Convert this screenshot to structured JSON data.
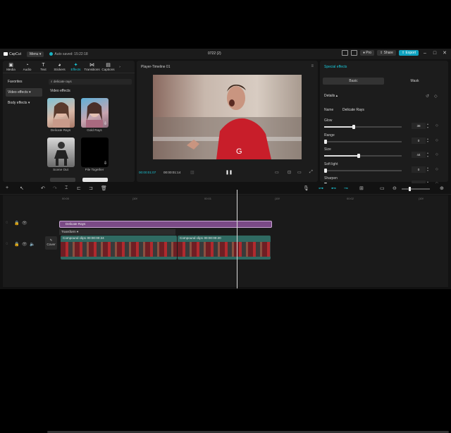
{
  "topbar": {
    "logo_text": "CapCut",
    "menu_label": "Menu",
    "autosave_text": "Auto saved: 15:22:18",
    "project_title": "0722 (2)",
    "pro_label": "Pro",
    "share_label": "Share",
    "export_label": "Export"
  },
  "toolbar": [
    {
      "icon": "media-icon",
      "glyph": "▣",
      "label": "Media"
    },
    {
      "icon": "audio-icon",
      "glyph": "◔",
      "label": "Audio"
    },
    {
      "icon": "text-icon",
      "glyph": "T",
      "label": "Text"
    },
    {
      "icon": "stickers-icon",
      "glyph": "◕",
      "label": "Stickers"
    },
    {
      "icon": "effects-icon",
      "glyph": "✦",
      "label": "Effects",
      "active": true
    },
    {
      "icon": "transitions-icon",
      "glyph": "⋈",
      "label": "Transitions"
    },
    {
      "icon": "captions-icon",
      "glyph": "▤",
      "label": "Captions"
    }
  ],
  "effects_panel": {
    "categories": [
      "Favorites",
      "Video effects",
      "Body effects"
    ],
    "search_value": "delicate rays",
    "section_label": "Video effects",
    "thumbs": [
      {
        "label": "Delicate Rays"
      },
      {
        "label": "Gold Rays"
      },
      {
        "label": "Scene Out"
      },
      {
        "label": "Pile Together"
      }
    ]
  },
  "player": {
    "title": "Player-Timeline 01",
    "current_time": "00:00:01:07",
    "total_time": "00:00:01:14"
  },
  "special_effects": {
    "heading": "Special effects",
    "tabs": [
      "Basic",
      "Mask"
    ],
    "details_label": "Details",
    "name_label": "Name",
    "name_value": "Delicate Rays",
    "params": [
      {
        "label": "Glow",
        "value": "38",
        "fraction": 0.38
      },
      {
        "label": "Range",
        "value": "0",
        "fraction": 0.0
      },
      {
        "label": "Size",
        "value": "44",
        "fraction": 0.44
      },
      {
        "label": "Soft light",
        "value": "0",
        "fraction": 0.0
      },
      {
        "label": "Sharpen",
        "value": "",
        "fraction": 0.0
      }
    ]
  },
  "timeline": {
    "ruler": [
      "00:00",
      "|10f",
      "00:01",
      "|10f",
      "00:02",
      "|10f"
    ],
    "effect_clip": "Delicate Rays",
    "transform_label": "Transform",
    "clips": [
      {
        "label": "Compound clip1  00:00:00:24"
      },
      {
        "label": "Compound clip1  00:00:00:20"
      }
    ],
    "cover_label": "Cover"
  }
}
